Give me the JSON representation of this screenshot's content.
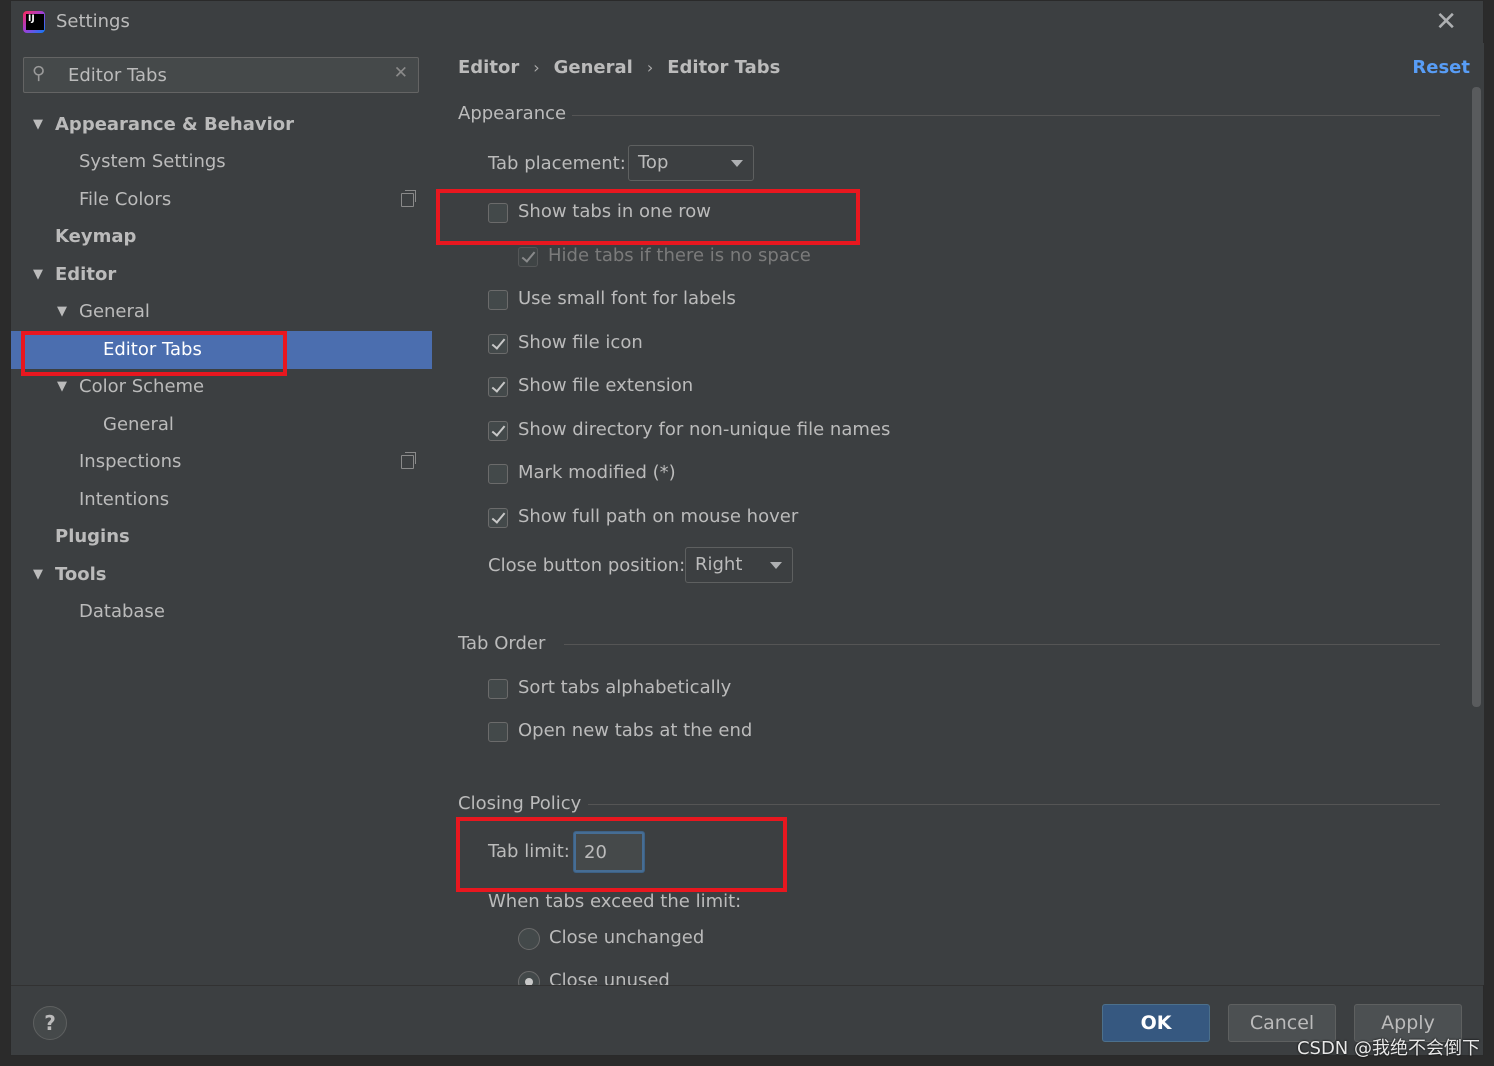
{
  "window": {
    "title": "Settings"
  },
  "search": {
    "value": "Editor Tabs"
  },
  "sidebar": {
    "items": [
      {
        "label": "Appearance & Behavior"
      },
      {
        "label": "System Settings"
      },
      {
        "label": "File Colors"
      },
      {
        "label": "Keymap"
      },
      {
        "label": "Editor"
      },
      {
        "label": "General"
      },
      {
        "label": "Editor Tabs"
      },
      {
        "label": "Color Scheme"
      },
      {
        "label": "General"
      },
      {
        "label": "Inspections"
      },
      {
        "label": "Intentions"
      },
      {
        "label": "Plugins"
      },
      {
        "label": "Tools"
      },
      {
        "label": "Database"
      }
    ]
  },
  "breadcrumb": [
    "Editor",
    "General",
    "Editor Tabs"
  ],
  "reset_label": "Reset",
  "appearance": {
    "title": "Appearance",
    "tab_placement_label": "Tab placement:",
    "tab_placement_value": "Top",
    "options": [
      {
        "label": "Show tabs in one row",
        "checked": false
      },
      {
        "label": "Hide tabs if there is no space",
        "checked": true,
        "disabled": true
      },
      {
        "label": "Use small font for labels",
        "checked": false
      },
      {
        "label": "Show file icon",
        "checked": true
      },
      {
        "label": "Show file extension",
        "checked": true
      },
      {
        "label": "Show directory for non-unique file names",
        "checked": true
      },
      {
        "label": "Mark modified (*)",
        "checked": false
      },
      {
        "label": "Show full path on mouse hover",
        "checked": true
      }
    ],
    "close_button_label": "Close button position:",
    "close_button_value": "Right"
  },
  "tab_order": {
    "title": "Tab Order",
    "options": [
      {
        "label": "Sort tabs alphabetically",
        "checked": false
      },
      {
        "label": "Open new tabs at the end",
        "checked": false
      }
    ]
  },
  "closing_policy": {
    "title": "Closing Policy",
    "tab_limit_label": "Tab limit:",
    "tab_limit_value": "20",
    "exceed_label": "When tabs exceed the limit:",
    "radios": [
      {
        "label": "Close unchanged",
        "checked": false
      },
      {
        "label": "Close unused",
        "checked": true
      }
    ]
  },
  "footer": {
    "help_label": "?",
    "ok_label": "OK",
    "cancel_label": "Cancel",
    "apply_label": "Apply"
  },
  "watermark": "CSDN @我绝不会倒下",
  "colors": {
    "accent": "#4b6eaf",
    "link": "#589df6",
    "highlight": "#e8171f"
  }
}
